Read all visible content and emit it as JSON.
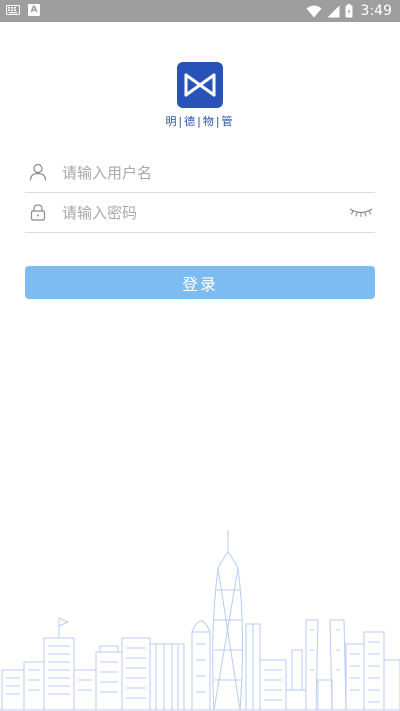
{
  "status_bar": {
    "time": "3:49",
    "notification_icons": [
      "keyboard-icon",
      "a-notification-icon"
    ],
    "system_icons": [
      "wifi-icon",
      "signal-icon",
      "battery-icon"
    ],
    "a_glyph": "A"
  },
  "logo": {
    "text": "明|德|物|管",
    "color": "#2952b8"
  },
  "login_form": {
    "username_placeholder": "请输入用户名",
    "password_placeholder": "请输入密码",
    "username_value": "",
    "password_value": ""
  },
  "login_button": {
    "label": "登录",
    "color": "#7cbcf0"
  },
  "decoration": {
    "skyline_color": "#b8cdf0"
  }
}
